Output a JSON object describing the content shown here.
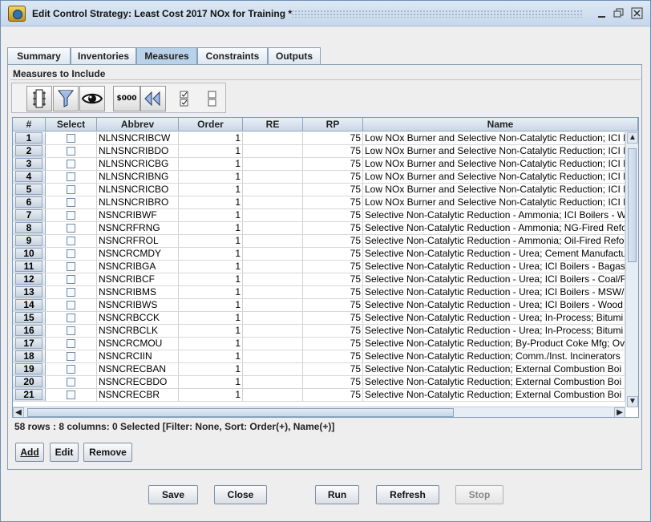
{
  "window": {
    "title": "Edit Control Strategy: Least Cost 2017 NOx for Training *",
    "controls": {
      "minimize": "minimize-icon",
      "maximize": "maximize-icon",
      "close": "close-icon"
    }
  },
  "tabs": [
    {
      "label": "Summary",
      "active": false
    },
    {
      "label": "Inventories",
      "active": false
    },
    {
      "label": "Measures",
      "active": true
    },
    {
      "label": "Constraints",
      "active": false
    },
    {
      "label": "Outputs",
      "active": false
    }
  ],
  "measures": {
    "section_label": "Measures to Include",
    "toolbar_icons": [
      "sort-columns-icon",
      "filter-icon",
      "view-icon",
      "format-currency-icon",
      "reset-icon",
      "select-all-icon",
      "clear-selection-icon"
    ],
    "currency_icon_text": "$000",
    "table": {
      "headers": [
        "#",
        "Select",
        "Abbrev",
        "Order",
        "RE",
        "RP",
        "Name"
      ],
      "rows": [
        {
          "num": "1",
          "abbrev": "NLNSNCRIBCW",
          "order": "1",
          "re": "",
          "rp": "75",
          "name": "Low NOx Burner and Selective Non-Catalytic Reduction; ICI E"
        },
        {
          "num": "2",
          "abbrev": "NLNSNCRIBDO",
          "order": "1",
          "re": "",
          "rp": "75",
          "name": "Low NOx Burner and Selective Non-Catalytic Reduction; ICI E"
        },
        {
          "num": "3",
          "abbrev": "NLNSNCRICBG",
          "order": "1",
          "re": "",
          "rp": "75",
          "name": "Low NOx Burner and Selective Non-Catalytic Reduction; ICI E"
        },
        {
          "num": "4",
          "abbrev": "NLNSNCRIBNG",
          "order": "1",
          "re": "",
          "rp": "75",
          "name": "Low NOx Burner and Selective Non-Catalytic Reduction; ICI E"
        },
        {
          "num": "5",
          "abbrev": "NLNSNCRICBO",
          "order": "1",
          "re": "",
          "rp": "75",
          "name": "Low NOx Burner and Selective Non-Catalytic Reduction; ICI E"
        },
        {
          "num": "6",
          "abbrev": "NLNSNCRIBRO",
          "order": "1",
          "re": "",
          "rp": "75",
          "name": "Low NOx Burner and Selective Non-Catalytic Reduction; ICI E"
        },
        {
          "num": "7",
          "abbrev": "NSNCRIBWF",
          "order": "1",
          "re": "",
          "rp": "75",
          "name": "Selective Non-Catalytic Reduction - Ammonia; ICI Boilers - W"
        },
        {
          "num": "8",
          "abbrev": "NSNCRFRNG",
          "order": "1",
          "re": "",
          "rp": "75",
          "name": "Selective Non-Catalytic Reduction - Ammonia; NG-Fired Refo"
        },
        {
          "num": "9",
          "abbrev": "NSNCRFROL",
          "order": "1",
          "re": "",
          "rp": "75",
          "name": "Selective Non-Catalytic Reduction - Ammonia; Oil-Fired Refo"
        },
        {
          "num": "10",
          "abbrev": "NSNCRCMDY",
          "order": "1",
          "re": "",
          "rp": "75",
          "name": "Selective Non-Catalytic Reduction - Urea; Cement Manufactu"
        },
        {
          "num": "11",
          "abbrev": "NSNCRIBGA",
          "order": "1",
          "re": "",
          "rp": "75",
          "name": "Selective Non-Catalytic Reduction - Urea; ICI Boilers - Bagas"
        },
        {
          "num": "12",
          "abbrev": "NSNCRIBCF",
          "order": "1",
          "re": "",
          "rp": "75",
          "name": "Selective Non-Catalytic Reduction - Urea; ICI Boilers - Coal/F"
        },
        {
          "num": "13",
          "abbrev": "NSNCRIBMS",
          "order": "1",
          "re": "",
          "rp": "75",
          "name": "Selective Non-Catalytic Reduction - Urea; ICI Boilers - MSW/S"
        },
        {
          "num": "14",
          "abbrev": "NSNCRIBWS",
          "order": "1",
          "re": "",
          "rp": "75",
          "name": "Selective Non-Catalytic Reduction - Urea; ICI Boilers - Wood"
        },
        {
          "num": "15",
          "abbrev": "NSNCRBCCK",
          "order": "1",
          "re": "",
          "rp": "75",
          "name": "Selective Non-Catalytic Reduction - Urea; In-Process; Bitumi"
        },
        {
          "num": "16",
          "abbrev": "NSNCRBCLK",
          "order": "1",
          "re": "",
          "rp": "75",
          "name": "Selective Non-Catalytic Reduction - Urea; In-Process; Bitumi"
        },
        {
          "num": "17",
          "abbrev": "NSNCRCMOU",
          "order": "1",
          "re": "",
          "rp": "75",
          "name": "Selective Non-Catalytic Reduction; By-Product Coke Mfg; Ove"
        },
        {
          "num": "18",
          "abbrev": "NSNCRCIIN",
          "order": "1",
          "re": "",
          "rp": "75",
          "name": "Selective Non-Catalytic Reduction; Comm./Inst. Incinerators"
        },
        {
          "num": "19",
          "abbrev": "NSNCRECBAN",
          "order": "1",
          "re": "",
          "rp": "75",
          "name": "Selective Non-Catalytic Reduction; External Combustion Boi"
        },
        {
          "num": "20",
          "abbrev": "NSNCRECBDO",
          "order": "1",
          "re": "",
          "rp": "75",
          "name": "Selective Non-Catalytic Reduction; External Combustion Boi"
        },
        {
          "num": "21",
          "abbrev": "NSNCRECBR",
          "order": "1",
          "re": "",
          "rp": "75",
          "name": "Selective Non-Catalytic Reduction; External Combustion Boi"
        }
      ]
    },
    "status": "58 rows : 8 columns: 0 Selected [Filter: None, Sort: Order(+), Name(+)]",
    "buttons": {
      "add": "Add",
      "edit": "Edit",
      "remove": "Remove"
    }
  },
  "footer_buttons": {
    "save": "Save",
    "close": "Close",
    "run": "Run",
    "refresh": "Refresh",
    "stop": "Stop"
  },
  "colors": {
    "titlebar": "#c7d7ea",
    "active_tab": "#b9d2ea",
    "table_header": "#cbd7e7"
  }
}
